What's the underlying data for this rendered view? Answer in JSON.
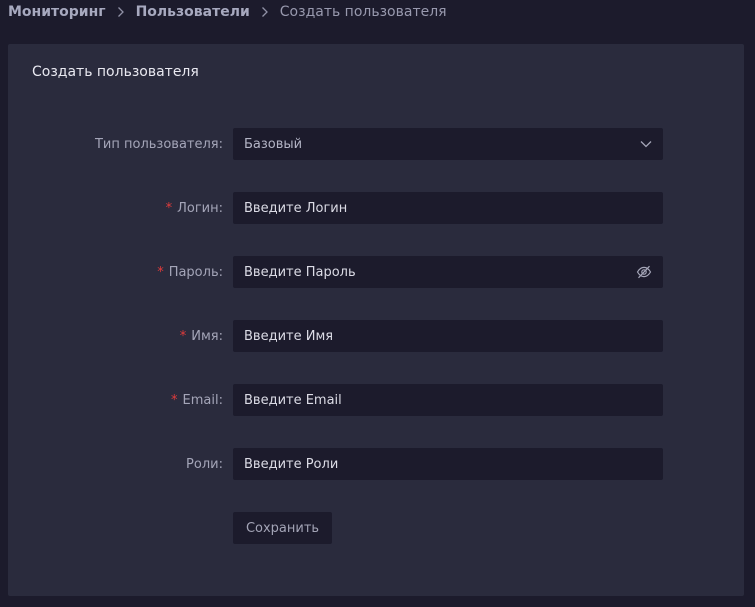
{
  "breadcrumb": {
    "items": [
      "Мониторинг",
      "Пользователи"
    ],
    "current": "Создать пользователя"
  },
  "card": {
    "title": "Создать пользователя"
  },
  "form": {
    "user_type": {
      "label": "Тип пользователя",
      "required": false,
      "value": "Базовый",
      "icon": "chevron-down-icon"
    },
    "login": {
      "label": "Логин",
      "required": true,
      "placeholder": "Введите Логин"
    },
    "password": {
      "label": "Пароль",
      "required": true,
      "placeholder": "Введите Пароль",
      "icon": "eye-slash-icon"
    },
    "name": {
      "label": "Имя",
      "required": true,
      "placeholder": "Введите Имя"
    },
    "email": {
      "label": "Email",
      "required": true,
      "placeholder": "Введите Email"
    },
    "roles": {
      "label": "Роли",
      "required": false,
      "placeholder": "Введите Роли"
    },
    "colon": ":",
    "required_mark": "*",
    "save_label": "Сохранить"
  },
  "colors": {
    "page_background": "#1c1b2c",
    "card_background": "#2a2b3d",
    "input_background": "#1c1b2c",
    "required_mark": "#e23c3c"
  }
}
